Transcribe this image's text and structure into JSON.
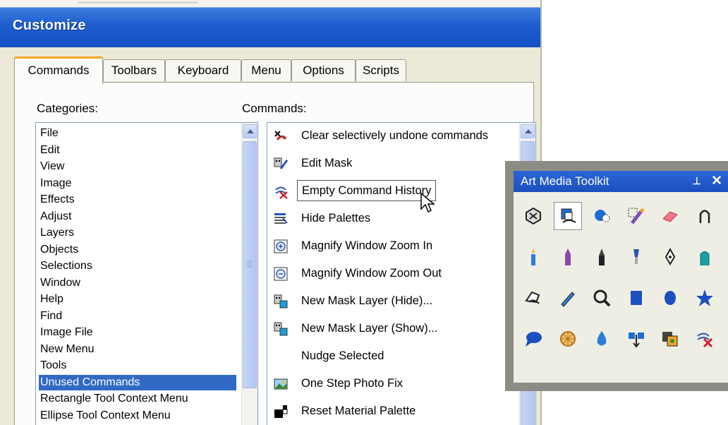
{
  "dialog": {
    "title": "Customize",
    "tabs": [
      {
        "label": "Commands",
        "active": true
      },
      {
        "label": "Toolbars",
        "active": false
      },
      {
        "label": "Keyboard",
        "active": false
      },
      {
        "label": "Menu",
        "active": false
      },
      {
        "label": "Options",
        "active": false
      },
      {
        "label": "Scripts",
        "active": false
      }
    ],
    "categories_label": "Categories:",
    "commands_label": "Commands:",
    "categories": [
      "File",
      "Edit",
      "View",
      "Image",
      "Effects",
      "Adjust",
      "Layers",
      "Objects",
      "Selections",
      "Window",
      "Help",
      "Find",
      "Image File",
      "New Menu",
      "Tools",
      "Unused Commands",
      "Rectangle Tool Context Menu",
      "Ellipse Tool Context Menu"
    ],
    "selected_category": "Unused Commands",
    "commands": [
      {
        "label": "Clear selectively undone commands",
        "icon": "clear-undo-icon"
      },
      {
        "label": "Edit Mask",
        "icon": "edit-mask-icon"
      },
      {
        "label": "Empty Command History",
        "icon": "empty-history-icon"
      },
      {
        "label": "Hide Palettes",
        "icon": "hide-palettes-icon"
      },
      {
        "label": "Magnify Window Zoom In",
        "icon": "zoom-in-icon"
      },
      {
        "label": "Magnify Window Zoom Out",
        "icon": "zoom-out-icon"
      },
      {
        "label": "New Mask Layer (Hide)...",
        "icon": "mask-layer-hide-icon"
      },
      {
        "label": "New Mask Layer (Show)...",
        "icon": "mask-layer-show-icon"
      },
      {
        "label": "Nudge Selected",
        "icon": ""
      },
      {
        "label": "One Step Photo Fix",
        "icon": "photo-fix-icon"
      },
      {
        "label": "Reset Material Palette",
        "icon": "reset-palette-icon"
      }
    ],
    "focused_command": "Empty Command History"
  },
  "toolkit": {
    "title": "Art Media Toolkit",
    "pin_glyph": "⊥",
    "close_glyph": "✕",
    "colors": {
      "title_bar": "#1c4fbf",
      "accent_tab": "#f5a623",
      "selection": "#316ac5"
    },
    "tools": [
      [
        "object-picker-icon",
        "mixer-icon",
        "color-fill-icon",
        "smudge-icon",
        "eraser-icon",
        "palette-knife-icon"
      ],
      [
        "candle-icon",
        "crayon-icon",
        "chalk-icon",
        "brush-icon",
        "pen-nib-icon",
        "marker-icon"
      ],
      [
        "finger-icon",
        "pencil-icon",
        "magnify-icon",
        "rectangle-icon",
        "ellipse-icon",
        "star-icon"
      ],
      [
        "speech-icon",
        "pattern-icon",
        "drop-icon",
        "move-icon",
        "picture-icon",
        "history-clear-icon"
      ]
    ],
    "active_tool": "mixer-icon"
  }
}
